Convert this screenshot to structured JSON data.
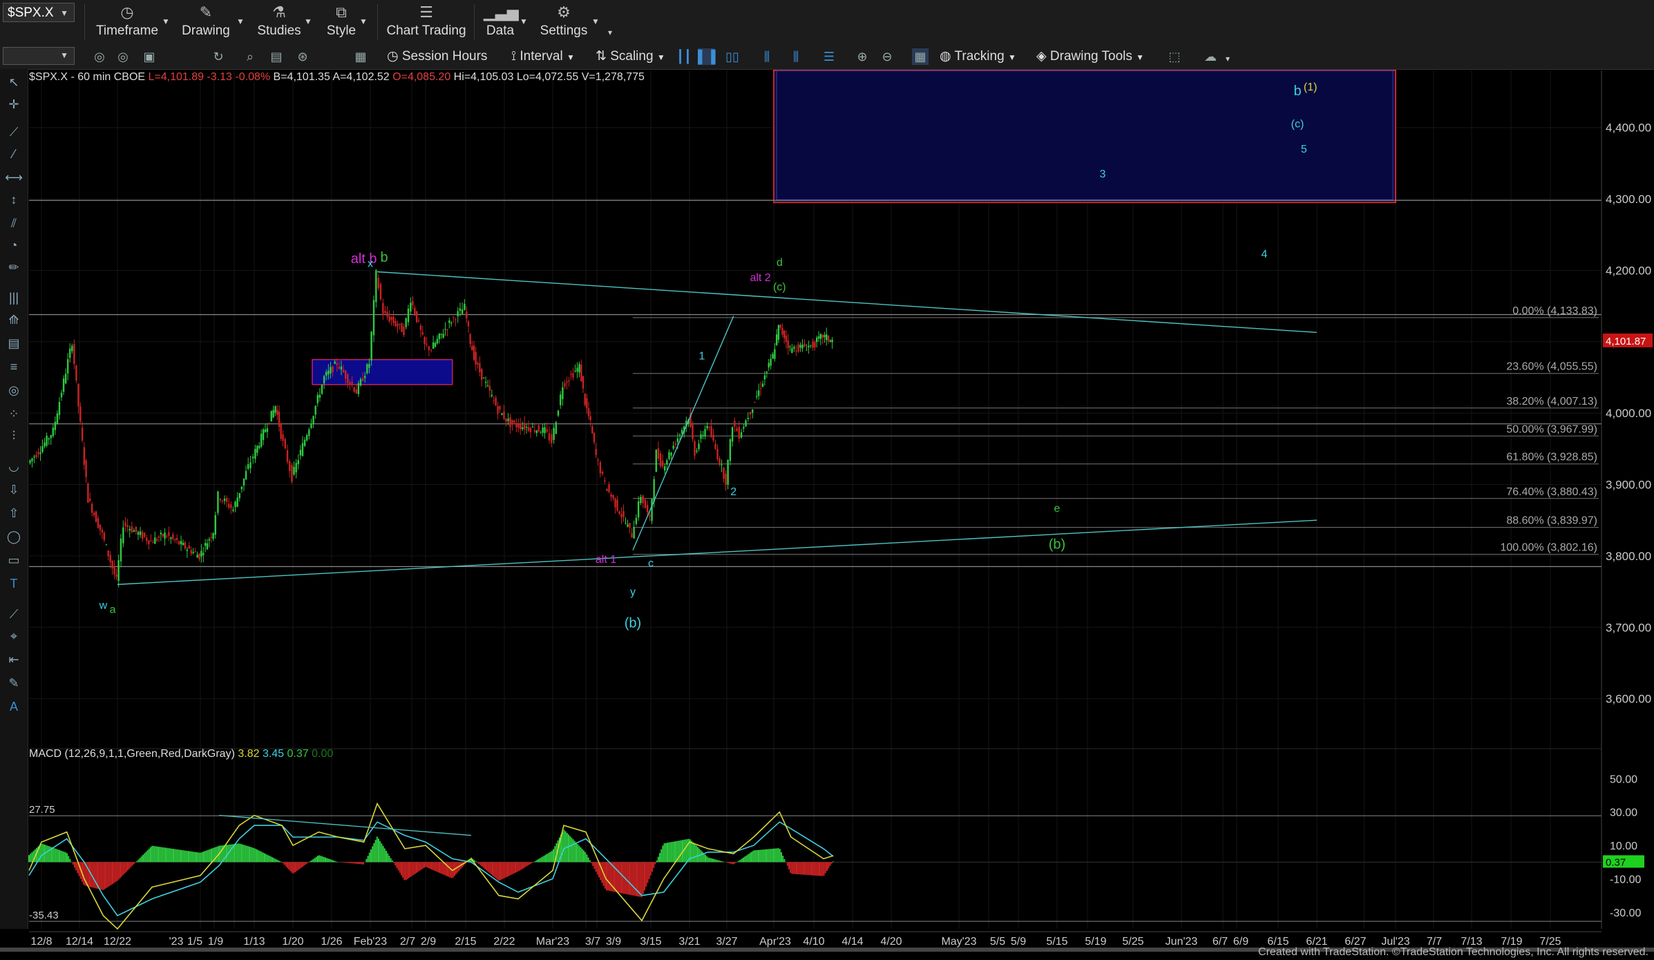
{
  "toolbar": {
    "symbol": "$SPX.X",
    "buttons": [
      {
        "label": "Timeframe",
        "icon": "clock-icon"
      },
      {
        "label": "Drawing",
        "icon": "pen-icon"
      },
      {
        "label": "Studies",
        "icon": "flask-icon"
      },
      {
        "label": "Style",
        "icon": "style-icon"
      },
      {
        "label": "Chart Trading",
        "icon": "chart-trading-icon"
      },
      {
        "label": "Data",
        "icon": "data-icon"
      },
      {
        "label": "Settings",
        "icon": "gear-icon"
      }
    ],
    "row2": {
      "session_hours": "Session Hours",
      "interval": "Interval",
      "scaling": "Scaling",
      "tracking": "Tracking",
      "drawing_tools": "Drawing Tools"
    }
  },
  "header": {
    "symbol_text": "$SPX.X - 60 min  CBOE",
    "last": "L=4,101.89",
    "change": "-3.13",
    "change_pct": "-0.08%",
    "bid": "B=4,101.35",
    "ask": "A=4,102.52",
    "open": "O=4,085.20",
    "high": "Hi=4,105.03",
    "low": "Lo=4,072.55",
    "volume": "V=1,278,775"
  },
  "macd": {
    "title": "MACD (12,26,9,1,1,Green,Red,DarkGray)",
    "v1": "3.82",
    "v2": "3.45",
    "v3": "0.37",
    "v4": "0.00",
    "level_high": "27.75",
    "level_low": "-35.43",
    "current": "0.37",
    "y_ticks": [
      "50.00",
      "30.00",
      "10.00",
      "-10.00",
      "-30.00"
    ]
  },
  "colors": {
    "background": "#000000",
    "price_up": "#2ecc40",
    "price_down": "#cc2222",
    "last_price_bg": "#c81414",
    "trendline": "#4fc3c3",
    "box_blue": "#0b0b8c",
    "box_outline_red": "#c82828",
    "wave_cyan": "#3fd0e0",
    "wave_green": "#39c439",
    "wave_magenta": "#d22fd2",
    "wave_yellow": "#d8d83a"
  },
  "footer": "Created with TradeStation. ©TradeStation Technologies, Inc. All rights reserved.",
  "chart_data": {
    "type": "line",
    "title": "$SPX.X - 60 min",
    "ylim": [
      3530,
      4480
    ],
    "y_ticks": [
      3600,
      3700,
      3800,
      3900,
      4000,
      4100,
      4200,
      4300,
      4400
    ],
    "y_tick_labels": [
      "3,600.00",
      "3,700.00",
      "3,800.00",
      "3,900.00",
      "4,000.00",
      "4,100.00",
      "4,200.00",
      "4,300.00",
      "4,400.00"
    ],
    "last_price_label": "4,101.87",
    "x_tick_labels": [
      "12/8",
      "12/14",
      "12/22",
      "'23",
      "1/5",
      "1/9",
      "1/13",
      "1/20",
      "1/26",
      "Feb'23",
      "2/7",
      "2/9",
      "2/15",
      "2/22",
      "Mar'23",
      "3/7",
      "3/9",
      "3/15",
      "3/21",
      "3/27",
      "Apr'23",
      "4/10",
      "4/14",
      "4/20",
      "May'23",
      "5/5",
      "5/9",
      "5/15",
      "5/19",
      "5/25",
      "Jun'23",
      "6/7",
      "6/9",
      "6/15",
      "6/21",
      "6/27",
      "Jul'23",
      "7/7",
      "7/13",
      "7/19",
      "7/25"
    ],
    "price_path": [
      [
        "12/5",
        3930
      ],
      [
        "12/8",
        3950
      ],
      [
        "12/10",
        3975
      ],
      [
        "12/13",
        4100
      ],
      [
        "12/14",
        4010
      ],
      [
        "12/16",
        3880
      ],
      [
        "12/19",
        3830
      ],
      [
        "12/22",
        3765
      ],
      [
        "12/23",
        3845
      ],
      [
        "12/27",
        3820
      ],
      [
        "12/29",
        3830
      ],
      [
        "1/3",
        3800
      ],
      [
        "1/5",
        3835
      ],
      [
        "1/6",
        3885
      ],
      [
        "1/9",
        3865
      ],
      [
        "1/12",
        3925
      ],
      [
        "1/13",
        3940
      ],
      [
        "1/17",
        4010
      ],
      [
        "1/18",
        3970
      ],
      [
        "1/20",
        3910
      ],
      [
        "1/23",
        3990
      ],
      [
        "1/25",
        4050
      ],
      [
        "1/27",
        4070
      ],
      [
        "1/30",
        4030
      ],
      [
        "2/1",
        4070
      ],
      [
        "2/2",
        4195
      ],
      [
        "2/3",
        4140
      ],
      [
        "2/6",
        4115
      ],
      [
        "2/7",
        4160
      ],
      [
        "2/9",
        4095
      ],
      [
        "2/10",
        4090
      ],
      [
        "2/13",
        4130
      ],
      [
        "2/15",
        4148
      ],
      [
        "2/16",
        4100
      ],
      [
        "2/17",
        4070
      ],
      [
        "2/21",
        4005
      ],
      [
        "2/23",
        3985
      ],
      [
        "2/28",
        3975
      ],
      [
        "3/1",
        3960
      ],
      [
        "3/3",
        4040
      ],
      [
        "3/6",
        4065
      ],
      [
        "3/7",
        4015
      ],
      [
        "3/8",
        3985
      ],
      [
        "3/9",
        3940
      ],
      [
        "3/10",
        3900
      ],
      [
        "3/13",
        3830
      ],
      [
        "3/14",
        3885
      ],
      [
        "3/15",
        3850
      ],
      [
        "3/16",
        3945
      ],
      [
        "3/17",
        3925
      ],
      [
        "3/21",
        3995
      ],
      [
        "3/22",
        3945
      ],
      [
        "3/24",
        3985
      ],
      [
        "3/27",
        3905
      ],
      [
        "3/28",
        3985
      ],
      [
        "3/29",
        3970
      ],
      [
        "3/31",
        4010
      ],
      [
        "4/3",
        4080
      ],
      [
        "4/4",
        4120
      ],
      [
        "4/5",
        4108
      ],
      [
        "4/6",
        4090
      ],
      [
        "4/10",
        4095
      ],
      [
        "4/11",
        4108
      ],
      [
        "4/12",
        4101
      ]
    ],
    "fib_levels": [
      {
        "label": "0.00% (4,133.83)",
        "value": 4133.83
      },
      {
        "label": "23.60% (4,055.55)",
        "value": 4055.55
      },
      {
        "label": "38.20% (4,007.13)",
        "value": 4007.13
      },
      {
        "label": "50.00% (3,967.99)",
        "value": 3967.99
      },
      {
        "label": "61.80% (3,928.85)",
        "value": 3928.85
      },
      {
        "label": "76.40% (3,880.43)",
        "value": 3880.43
      },
      {
        "label": "88.60% (3,839.97)",
        "value": 3839.97
      },
      {
        "label": "100.00% (3,802.16)",
        "value": 3802.16
      }
    ],
    "horizontal_lines": [
      4298,
      4138,
      3985,
      3785
    ],
    "trendlines": [
      {
        "from": [
          "2/2",
          4198
        ],
        "to": [
          "6/21",
          4113
        ]
      },
      {
        "from": [
          "12/22",
          3760
        ],
        "to": [
          "6/21",
          3850
        ]
      },
      {
        "from": [
          "3/13",
          3808
        ],
        "to": [
          "3/28",
          4136
        ]
      }
    ],
    "target_box": {
      "from_date": "4/3",
      "to_date": "7/1",
      "low": 4295,
      "high": 4480
    },
    "small_box": {
      "from_date": "1/23",
      "to_date": "2/13",
      "low": 4040,
      "high": 4075
    },
    "wave_labels": [
      {
        "text": "alt b",
        "date": "1/31",
        "value": 4210,
        "color": "magenta"
      },
      {
        "text": "x",
        "date": "2/1",
        "value": 4205,
        "color": "cyan"
      },
      {
        "text": "b",
        "date": "2/3",
        "value": 4212,
        "color": "green"
      },
      {
        "text": "alt 2",
        "date": "4/1",
        "value": 4185,
        "color": "magenta"
      },
      {
        "text": "d",
        "date": "4/4",
        "value": 4206,
        "color": "green"
      },
      {
        "text": "(c)",
        "date": "4/4",
        "value": 4172,
        "color": "green"
      },
      {
        "text": "1",
        "date": "3/23",
        "value": 4075,
        "color": "cyan"
      },
      {
        "text": "2",
        "date": "3/28",
        "value": 3885,
        "color": "cyan"
      },
      {
        "text": "alt 1",
        "date": "3/10",
        "value": 3790,
        "color": "magenta"
      },
      {
        "text": "c",
        "date": "3/15",
        "value": 3785,
        "color": "cyan"
      },
      {
        "text": "y",
        "date": "3/13",
        "value": 3745,
        "color": "cyan"
      },
      {
        "text": "(b)",
        "date": "3/13",
        "value": 3700,
        "color": "cyan"
      },
      {
        "text": "w",
        "date": "12/19",
        "value": 3726,
        "color": "cyan"
      },
      {
        "text": "a",
        "date": "12/21",
        "value": 3720,
        "color": "green"
      },
      {
        "text": "e",
        "date": "5/15",
        "value": 3862,
        "color": "green"
      },
      {
        "text": "(b)",
        "date": "5/15",
        "value": 3810,
        "color": "green"
      },
      {
        "text": "3",
        "date": "5/21",
        "value": 4330,
        "color": "cyan"
      },
      {
        "text": "4",
        "date": "6/13",
        "value": 4218,
        "color": "cyan"
      },
      {
        "text": "b",
        "date": "6/18",
        "value": 4445,
        "color": "cyan"
      },
      {
        "text": "(1)",
        "date": "6/20",
        "value": 4452,
        "color": "yellow"
      },
      {
        "text": "(c)",
        "date": "6/18",
        "value": 4400,
        "color": "cyan"
      },
      {
        "text": "5",
        "date": "6/19",
        "value": 4365,
        "color": "cyan"
      }
    ],
    "macd_series": {
      "ylim": [
        -40,
        58
      ],
      "dates": [
        "12/5",
        "12/8",
        "12/12",
        "12/15",
        "12/19",
        "12/22",
        "12/27",
        "1/3",
        "1/6",
        "1/10",
        "1/13",
        "1/18",
        "1/20",
        "1/24",
        "1/27",
        "1/31",
        "2/2",
        "2/6",
        "2/9",
        "2/13",
        "2/16",
        "2/21",
        "2/24",
        "3/1",
        "3/3",
        "3/7",
        "3/10",
        "3/14",
        "3/17",
        "3/21",
        "3/24",
        "3/28",
        "3/31",
        "4/4",
        "4/6",
        "4/11",
        "4/12"
      ],
      "macd": [
        -5,
        12,
        18,
        -10,
        -32,
        -40,
        -15,
        -8,
        5,
        22,
        28,
        22,
        10,
        18,
        15,
        12,
        35,
        8,
        10,
        -5,
        2,
        -20,
        -22,
        -5,
        22,
        18,
        -10,
        -35,
        -10,
        12,
        8,
        5,
        15,
        30,
        15,
        2,
        3.82
      ],
      "signal": [
        -8,
        4,
        14,
        0,
        -20,
        -32,
        -22,
        -12,
        -2,
        14,
        22,
        22,
        15,
        15,
        15,
        13,
        24,
        16,
        12,
        2,
        0,
        -12,
        -18,
        -10,
        8,
        14,
        2,
        -20,
        -18,
        2,
        6,
        6,
        10,
        24,
        20,
        8,
        3.45
      ],
      "trendline": {
        "from": [
          "1/6",
          28
        ],
        "to": [
          "2/16",
          16
        ]
      }
    }
  }
}
